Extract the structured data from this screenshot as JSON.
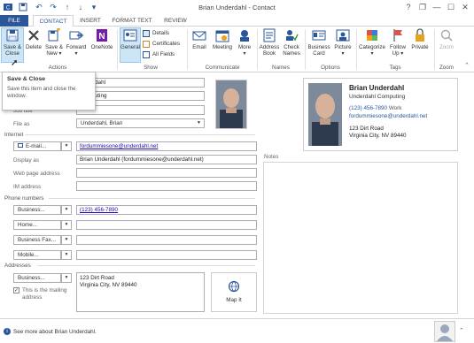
{
  "window": {
    "title": "Brian Underdahl - Contact",
    "help": "?",
    "restore": "❐",
    "minimize": "—",
    "maximize": "☐",
    "close": "✕"
  },
  "tabs": {
    "file": "FILE",
    "contact": "CONTACT",
    "insert": "INSERT",
    "format_text": "FORMAT TEXT",
    "review": "REVIEW"
  },
  "ribbon": {
    "save_close": "Save &",
    "save_close2": "Close",
    "delete": "Delete",
    "save_new": "Save &",
    "save_new2": "New ▾",
    "forward": "Forward",
    "forward2": "▾",
    "onenote": "OneNote",
    "general": "General",
    "details": "Details",
    "certificates": "Certificates",
    "all_fields": "All Fields",
    "email": "Email",
    "meeting": "Meeting",
    "more": "More",
    "more2": "▾",
    "address_book": "Address",
    "address_book2": "Book",
    "check_names": "Check",
    "check_names2": "Names",
    "business_card": "Business",
    "business_card2": "Card",
    "picture": "Picture",
    "picture2": "▾",
    "categorize": "Categorize",
    "categorize2": "▾",
    "follow_up": "Follow",
    "follow_up2": "Up ▾",
    "private": "Private",
    "zoom": "Zoom",
    "groups": {
      "actions": "Actions",
      "show": "Show",
      "communicate": "Communicate",
      "names": "Names",
      "options": "Options",
      "tags": "Tags",
      "zoom": "Zoom"
    }
  },
  "tooltip": {
    "title": "Save & Close",
    "body1": "Save this item and close the",
    "body2": "window."
  },
  "form": {
    "full_name_tail": "Underdahl",
    "company_tail": "Computing",
    "job_title_label": "Job title",
    "file_as_label": "File as",
    "file_as_value": "Underdahl, Brian",
    "internet_label": "Internet",
    "email_button": "E-mail...",
    "email_value": "fordummiesone@underdahl.net",
    "display_as_label": "Display as",
    "display_as_value": "Brian Underdahl (fordummiesone@underdahl.net)",
    "web_label": "Web page address",
    "im_label": "IM address",
    "phone_label": "Phone numbers",
    "phones": [
      {
        "type": "Business...",
        "value": "(123) 456-7890"
      },
      {
        "type": "Home...",
        "value": ""
      },
      {
        "type": "Business Fax...",
        "value": ""
      },
      {
        "type": "Mobile...",
        "value": ""
      }
    ],
    "addresses_label": "Addresses",
    "address_type": "Business...",
    "address_line1": "123 Dirt Road",
    "address_line2": "Virginia City, NV 89440",
    "mailing_label1": "This is the mailing",
    "mailing_label2": "address",
    "map_it": "Map It",
    "notes_label": "Notes"
  },
  "card": {
    "name": "Brian Underdahl",
    "company": "Underdahl Computing",
    "phone": "(123) 456-7890",
    "phone_label": "Work",
    "email": "fordummiesone@underdahl.net",
    "addr1": "123 Dirt Road",
    "addr2": "Virginia City, NV 89440"
  },
  "status": {
    "text": "See more about Brian Underdahl."
  },
  "colors": {
    "accent": "#2b579a",
    "link": "#1a0dab",
    "onenote": "#7719aa"
  }
}
